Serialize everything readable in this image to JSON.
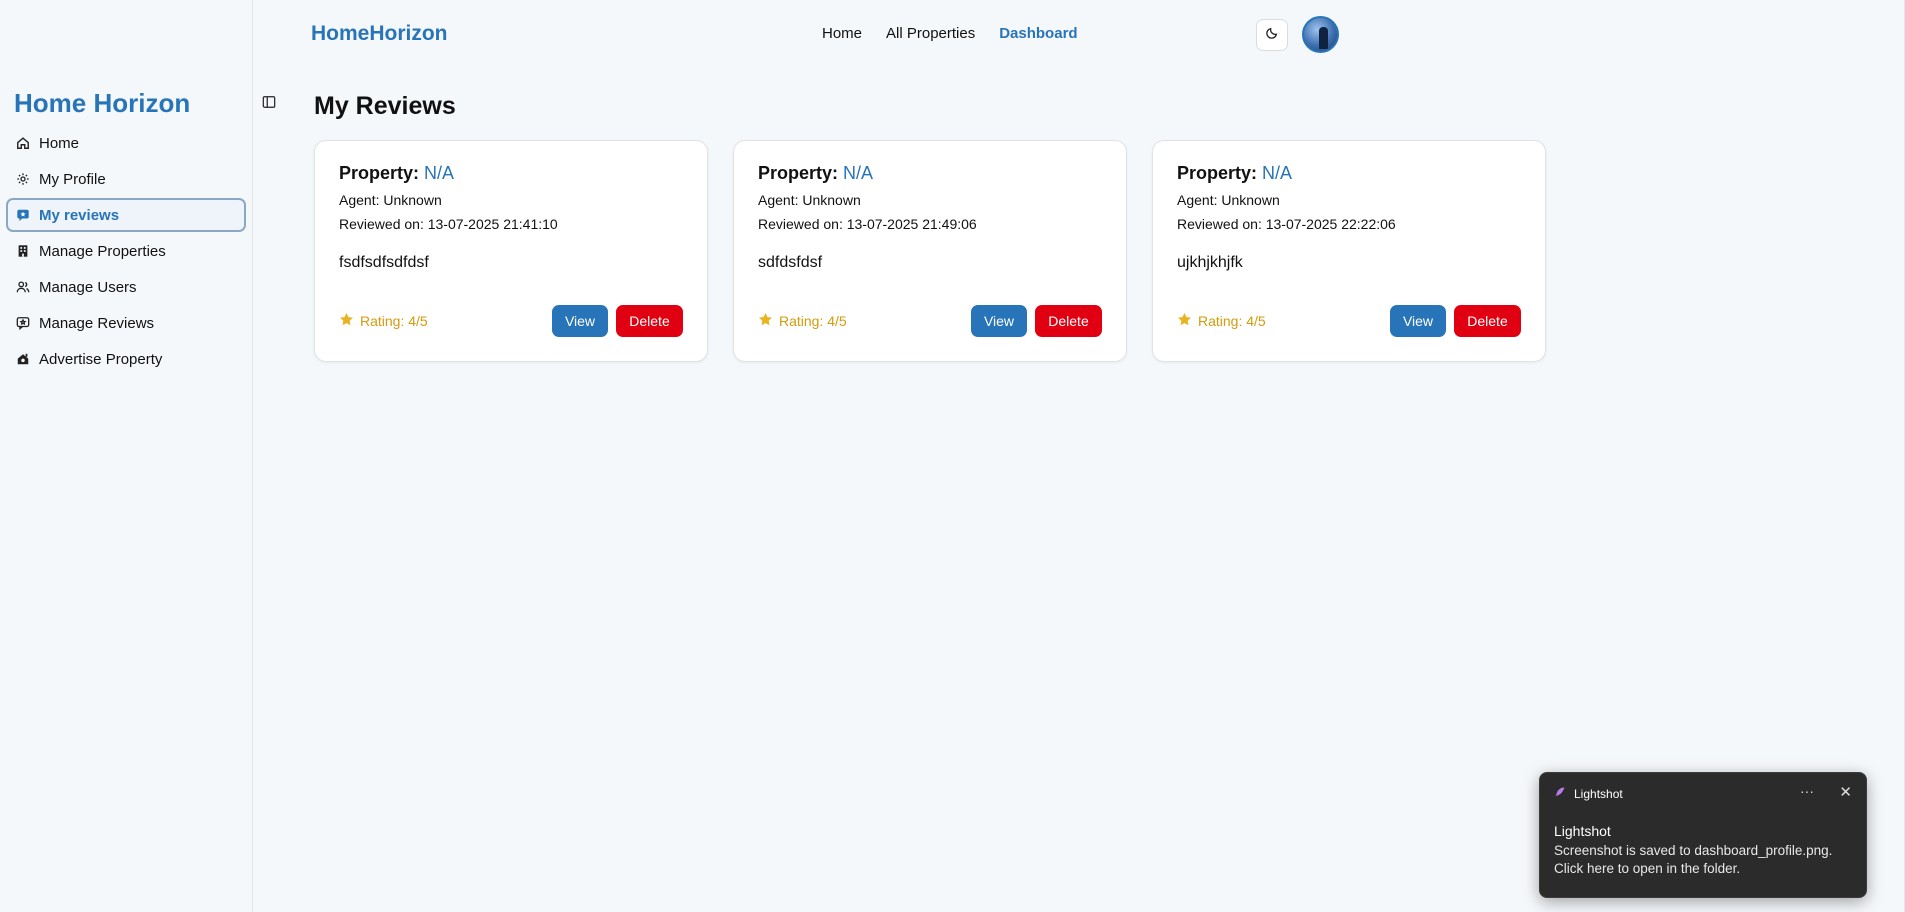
{
  "sidebar": {
    "brand": "Home Horizon",
    "items": [
      {
        "label": "Home",
        "icon": "home-icon"
      },
      {
        "label": "My Profile",
        "icon": "gear-icon"
      },
      {
        "label": "My reviews",
        "icon": "review-icon",
        "active": true
      },
      {
        "label": "Manage Properties",
        "icon": "building-icon"
      },
      {
        "label": "Manage Users",
        "icon": "users-icon"
      },
      {
        "label": "Manage Reviews",
        "icon": "message-icon"
      },
      {
        "label": "Advertise Property",
        "icon": "advertise-icon"
      }
    ]
  },
  "header": {
    "brand": "HomeHorizon",
    "nav": [
      {
        "label": "Home"
      },
      {
        "label": "All Properties"
      },
      {
        "label": "Dashboard",
        "active": true
      }
    ],
    "theme_icon": "moon-icon"
  },
  "main": {
    "title": "My Reviews",
    "reviews": [
      {
        "property_label": "Property:",
        "property": "N/A",
        "agent": "Agent: Unknown",
        "date": "Reviewed on: 13-07-2025 21:41:10",
        "comment": "fsdfsdfsdfdsf",
        "rating": "Rating: 4/5",
        "view": "View",
        "delete": "Delete"
      },
      {
        "property_label": "Property:",
        "property": "N/A",
        "agent": "Agent: Unknown",
        "date": "Reviewed on: 13-07-2025 21:49:06",
        "comment": "sdfdsfdsf",
        "rating": "Rating: 4/5",
        "view": "View",
        "delete": "Delete"
      },
      {
        "property_label": "Property:",
        "property": "N/A",
        "agent": "Agent: Unknown",
        "date": "Reviewed on: 13-07-2025 22:22:06",
        "comment": "ujkhjkhjfk",
        "rating": "Rating: 4/5",
        "view": "View",
        "delete": "Delete"
      }
    ]
  },
  "toast": {
    "app": "Lightshot",
    "more": "···",
    "close": "✕",
    "title": "Lightshot",
    "message": "Screenshot is saved to dashboard_profile.png. Click here to open in the folder."
  },
  "colors": {
    "accent": "#2874b8",
    "danger": "#e00012",
    "star": "#e8b421",
    "rating_text": "#d39b0d"
  }
}
